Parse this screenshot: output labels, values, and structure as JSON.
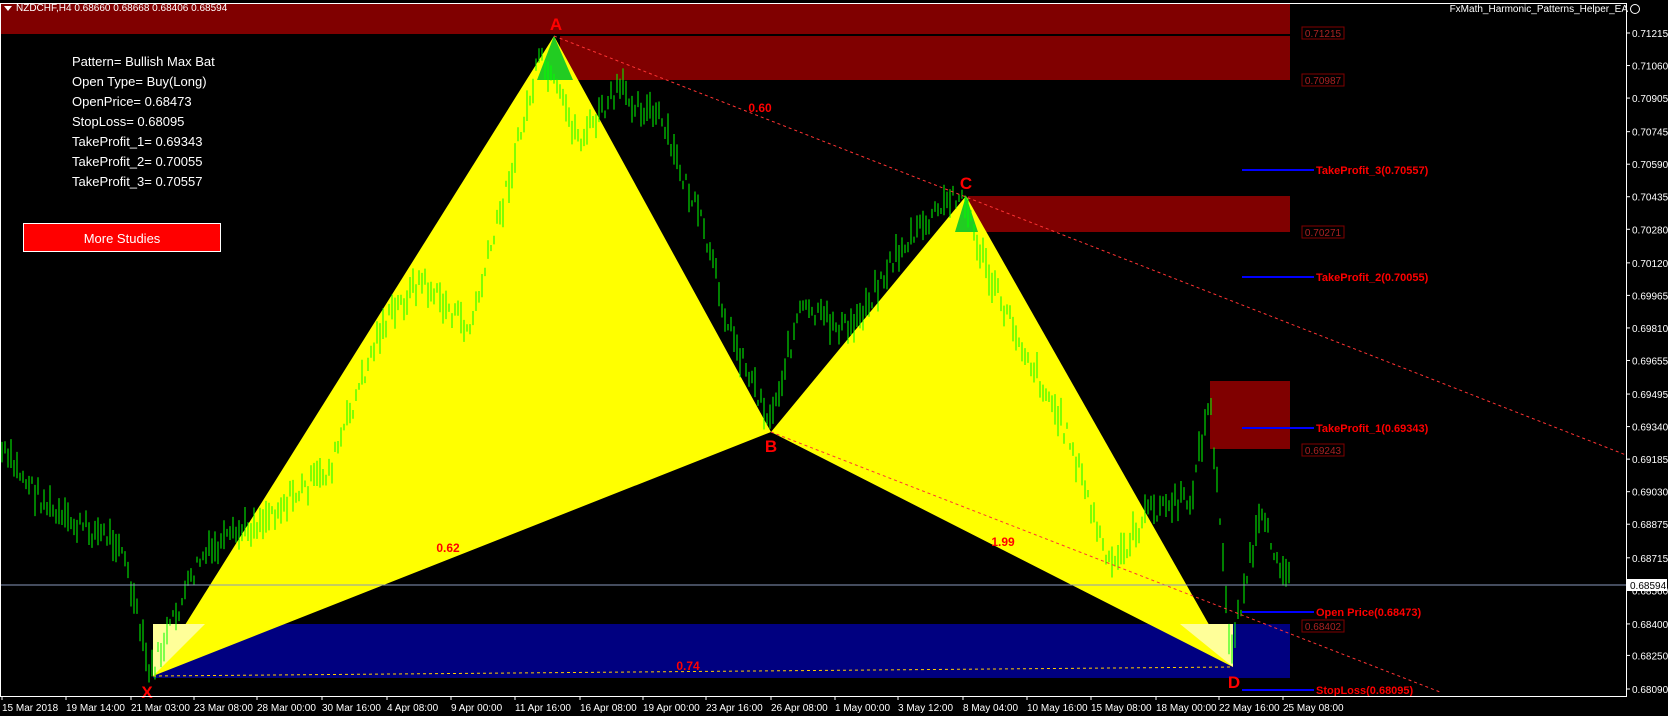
{
  "chart_header": {
    "symbol_text": "NZDCHF,H4  0.68660 0.68668 0.68406 0.68594",
    "ea_name": "FxMath_Harmonic_Patterns_Helper_EA"
  },
  "info_panel": {
    "pattern": "Pattern= Bullish Max Bat",
    "open_type": "Open Type= Buy(Long)",
    "open_price": "OpenPrice= 0.68473",
    "stop_loss": "StopLoss= 0.68095",
    "take_profit_1": "TakeProfit_1= 0.69343",
    "take_profit_2": "TakeProfit_2= 0.70055",
    "take_profit_3": "TakeProfit_3= 0.70557"
  },
  "more_studies_label": "More Studies",
  "chart_data": {
    "type": "candlestick",
    "price_axis": {
      "ticks": [
        "0.71215",
        "0.71060",
        "0.70905",
        "0.70745",
        "0.70590",
        "0.70435",
        "0.70280",
        "0.70120",
        "0.69965",
        "0.69810",
        "0.69655",
        "0.69495",
        "0.69340",
        "0.69185",
        "0.69030",
        "0.68875",
        "0.68715",
        "0.68560",
        "0.68400",
        "0.68250",
        "0.68090"
      ],
      "tick_values": [
        0.71215,
        0.7106,
        0.70905,
        0.70745,
        0.7059,
        0.70435,
        0.7028,
        0.7012,
        0.69965,
        0.6981,
        0.69655,
        0.69495,
        0.6934,
        0.69185,
        0.6903,
        0.68875,
        0.68715,
        0.6856,
        0.684,
        0.6825,
        0.6809
      ],
      "current_price": "0.68594"
    },
    "time_axis": [
      "15 Mar 2018",
      "19 Mar 14:00",
      "21 Mar 03:00",
      "23 Mar 08:00",
      "28 Mar 00:00",
      "30 Mar 16:00",
      "4 Apr 08:00",
      "9 Apr 00:00",
      "11 Apr 16:00",
      "16 Apr 08:00",
      "19 Apr 00:00",
      "23 Apr 16:00",
      "26 Apr 08:00",
      "1 May 00:00",
      "3 May 12:00",
      "8 May 04:00",
      "10 May 16:00",
      "15 May 08:00",
      "18 May 00:00",
      "22 May 16:00",
      "25 May 08:00"
    ],
    "pattern_points": [
      {
        "label": "X",
        "price": 0.68095
      },
      {
        "label": "A",
        "price": 0.712
      },
      {
        "label": "B",
        "price": 0.6931
      },
      {
        "label": "C",
        "price": 0.70435
      },
      {
        "label": "D",
        "price": 0.6815
      }
    ],
    "ratios": [
      {
        "text": "0.62",
        "leg": "XB"
      },
      {
        "text": "0.60",
        "leg": "AC"
      },
      {
        "text": "1.99",
        "leg": "BD"
      },
      {
        "text": "0.74",
        "leg": "XD"
      }
    ],
    "zone_labels": [
      "0.71215",
      "0.70987",
      "0.70271",
      "0.69243",
      "0.68402"
    ],
    "trade_levels": [
      {
        "label": "TakeProfit_3(0.70557)",
        "price": 0.70557
      },
      {
        "label": "TakeProfit_2(0.70055)",
        "price": 0.70055
      },
      {
        "label": "TakeProfit_1(0.69343)",
        "price": 0.69343
      },
      {
        "label": "Open Price(0.68473)",
        "price": 0.68473
      },
      {
        "label": "StopLoss(0.68095)",
        "price": 0.68095
      }
    ],
    "colors": {
      "background": "#000000",
      "candles": "#00ff00",
      "pattern_fill": "#ffff00",
      "supply_zone": "#800000",
      "demand_zone": "#000080",
      "point_labels": "#ff0000",
      "level_lines": "#0000ff",
      "level_text": "#ff0000"
    }
  }
}
